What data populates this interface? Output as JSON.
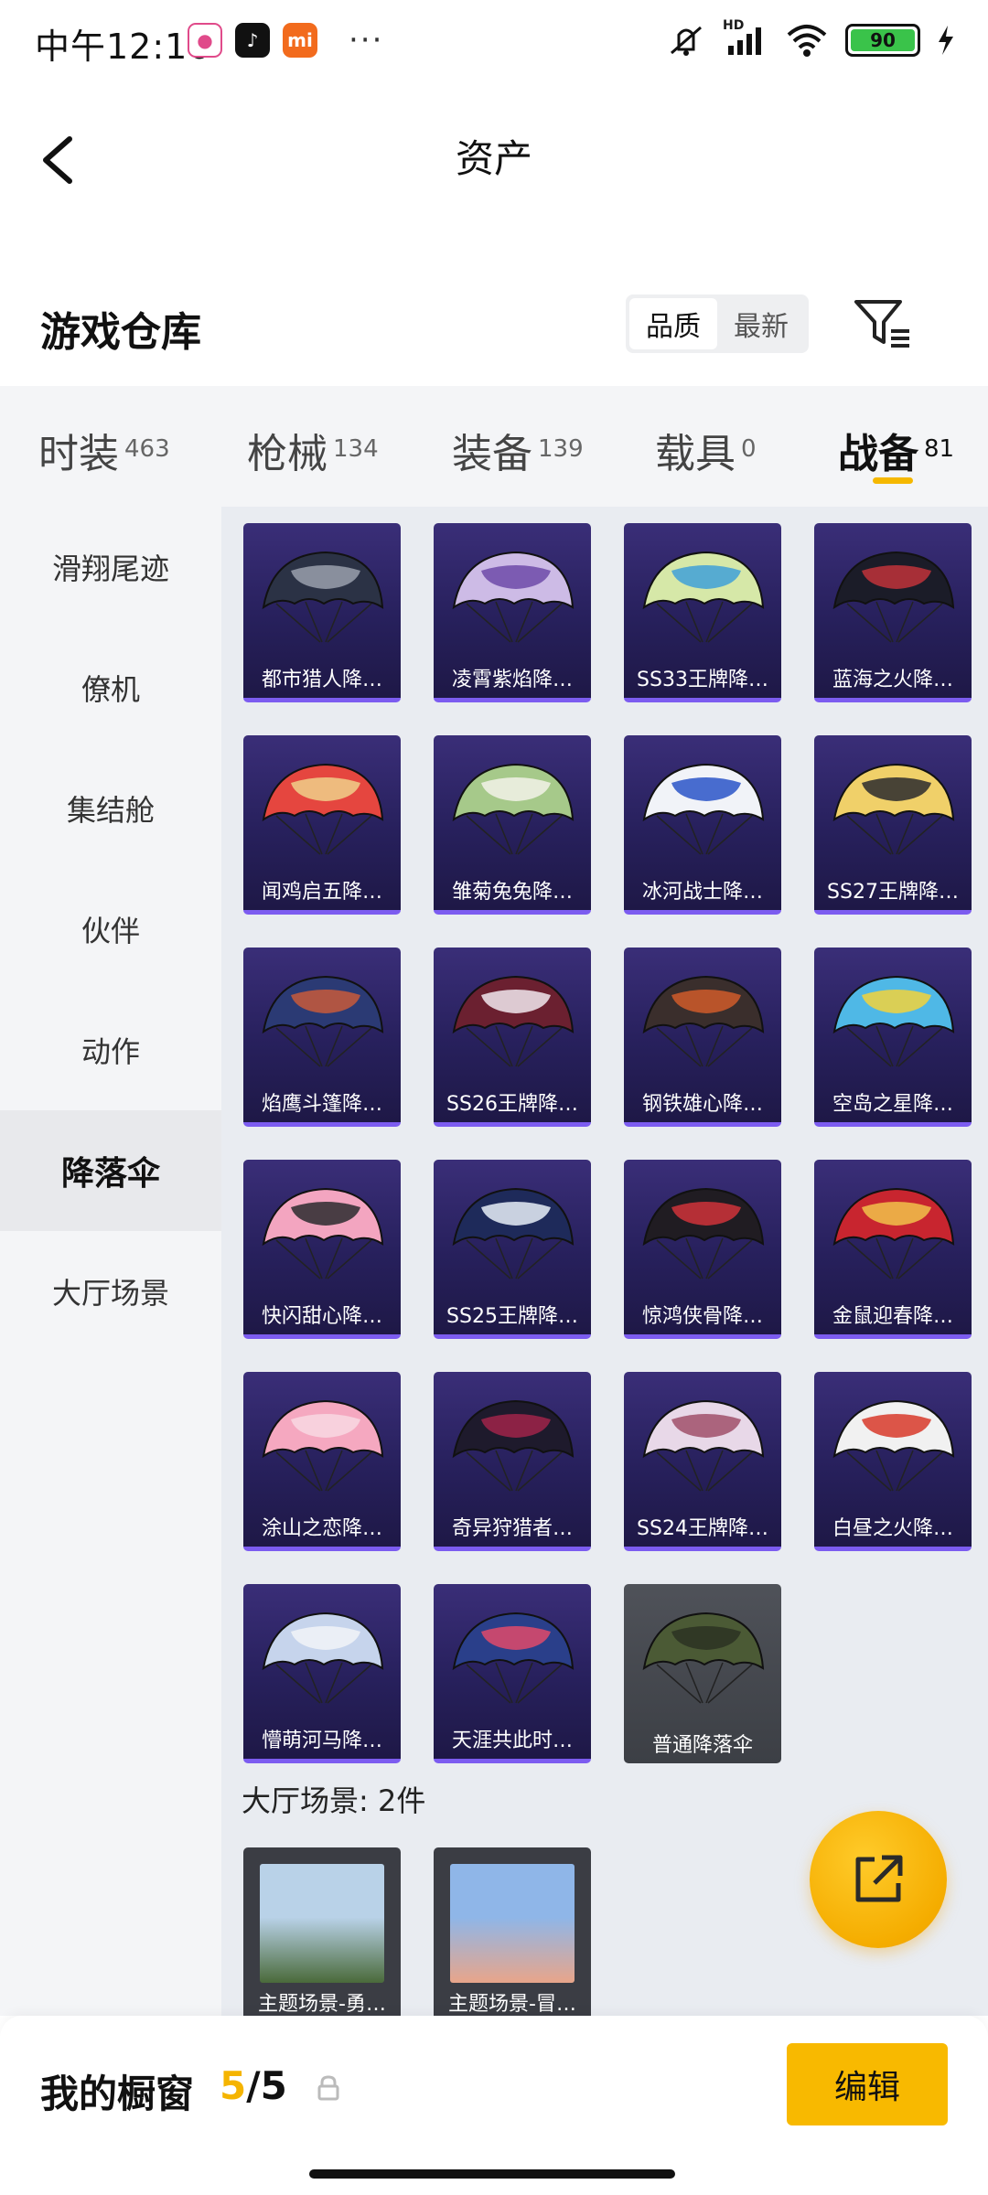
{
  "status_bar": {
    "time": "中午12:16",
    "battery": "90",
    "hd_label": "HD",
    "more": "···"
  },
  "header": {
    "title": "资产"
  },
  "section": {
    "title": "游戏仓库",
    "sort_options": [
      "品质",
      "最新"
    ],
    "sort_selected": "品质"
  },
  "tabs": [
    {
      "label": "时装",
      "count": "463"
    },
    {
      "label": "枪械",
      "count": "134"
    },
    {
      "label": "装备",
      "count": "139"
    },
    {
      "label": "载具",
      "count": "0"
    },
    {
      "label": "战备",
      "count": "81",
      "active": true
    }
  ],
  "sidebar": {
    "items": [
      "滑翔尾迹",
      "僚机",
      "集结舱",
      "伙伴",
      "动作",
      "降落伞",
      "大厅场景"
    ],
    "active": "降落伞"
  },
  "items": [
    {
      "label": "都市猎人降…",
      "colors": [
        "#2b3245",
        "#9aa0ad"
      ]
    },
    {
      "label": "凌霄紫焰降…",
      "colors": [
        "#cdbbe6",
        "#6d4aa8"
      ]
    },
    {
      "label": "SS33王牌降…",
      "colors": [
        "#d6e8a8",
        "#3fa0d8"
      ]
    },
    {
      "label": "蓝海之火降…",
      "colors": [
        "#1b1c28",
        "#c0333a"
      ]
    },
    {
      "label": "闻鸡启五降…",
      "colors": [
        "#e5463f",
        "#f0d08a"
      ]
    },
    {
      "label": "雏菊兔兔降…",
      "colors": [
        "#a6c98a",
        "#f2f2e8"
      ]
    },
    {
      "label": "冰河战士降…",
      "colors": [
        "#f1f3f8",
        "#2a54c8"
      ]
    },
    {
      "label": "SS27王牌降…",
      "colors": [
        "#f0d069",
        "#2a2a2e"
      ]
    },
    {
      "label": "焰鹰斗篷降…",
      "colors": [
        "#2b3a74",
        "#c85a3b"
      ]
    },
    {
      "label": "SS26王牌降…",
      "colors": [
        "#6b2030",
        "#f1e9ee"
      ]
    },
    {
      "label": "钢铁雄心降…",
      "colors": [
        "#3a2e2c",
        "#d05a2a"
      ]
    },
    {
      "label": "空岛之星降…",
      "colors": [
        "#4fb8e6",
        "#f2d23b"
      ]
    },
    {
      "label": "快闪甜心降…",
      "colors": [
        "#f3a5c0",
        "#2a2a2e"
      ]
    },
    {
      "label": "SS25王牌降…",
      "colors": [
        "#1e2a5a",
        "#e8eef8"
      ]
    },
    {
      "label": "惊鸿侠骨降…",
      "colors": [
        "#201c22",
        "#d0323a"
      ]
    },
    {
      "label": "金鼠迎春降…",
      "colors": [
        "#c8252f",
        "#f1c24a"
      ]
    },
    {
      "label": "涂山之恋降…",
      "colors": [
        "#f5a8c0",
        "#f8d8e2"
      ]
    },
    {
      "label": "奇异狩猎者…",
      "colors": [
        "#1e1a2c",
        "#a0244a"
      ]
    },
    {
      "label": "SS24王牌降…",
      "colors": [
        "#e8d8e8",
        "#a0506a"
      ]
    },
    {
      "label": "白昼之火降…",
      "colors": [
        "#f1f1f1",
        "#d83a2a"
      ]
    },
    {
      "label": "懵萌河马降…",
      "colors": [
        "#c6d4ec",
        "#f1f3f8"
      ]
    },
    {
      "label": "天涯共此时…",
      "colors": [
        "#2a3f8a",
        "#e04a6a"
      ]
    },
    {
      "label": "普通降落伞",
      "colors": [
        "#4b5a35",
        "#2b3322"
      ],
      "gray": true
    }
  ],
  "lobby": {
    "title": "大厅场景: 2件",
    "scenes": [
      {
        "label": "主题场景-勇…",
        "colors": [
          "#b9d2e8",
          "#4a6a3a"
        ]
      },
      {
        "label": "主题场景-冒…",
        "colors": [
          "#8fb6e8",
          "#e8a58a"
        ]
      }
    ]
  },
  "bottom": {
    "label": "我的橱窗",
    "current": "5",
    "separator": "/",
    "total": "5",
    "edit": "编辑"
  }
}
